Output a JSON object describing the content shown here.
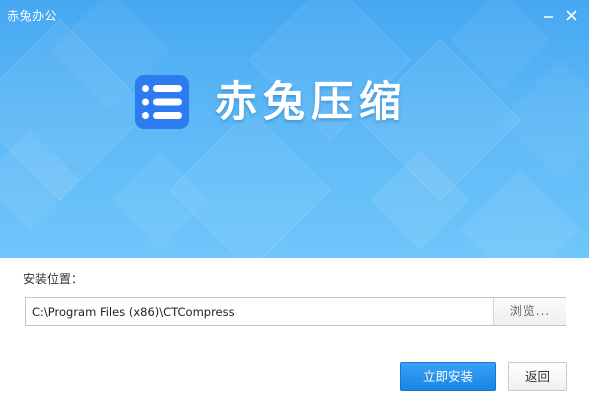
{
  "window": {
    "title": "赤兔办公",
    "controls": {
      "minimize_icon": "minimize-icon",
      "close_icon": "close-icon"
    }
  },
  "banner": {
    "logo_icon": "app-logo-icon",
    "app_name": "赤兔压缩",
    "colors": {
      "top": "#46a8f2",
      "bottom": "#6fc6fa",
      "logo_blue": "#2d7bf0"
    }
  },
  "install": {
    "location_label": "安装位置：",
    "path_value": "C:\\Program Files (x86)\\CTCompress",
    "browse_label": "浏览...",
    "install_label": "立即安装",
    "back_label": "返回"
  },
  "accent_color": "#1f8ced"
}
